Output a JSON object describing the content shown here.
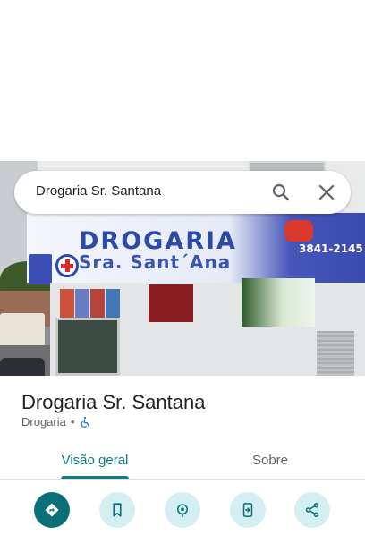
{
  "search": {
    "query": "Drogaria Sr. Santana"
  },
  "photo": {
    "sign_title": "DROGARIA",
    "sign_subtitle": "Sra. Sant´Ana",
    "sign_phone": "3841-2145"
  },
  "place": {
    "name": "Drogaria Sr. Santana",
    "category": "Drogaria",
    "separator": "•"
  },
  "tabs": [
    {
      "label": "Visão geral",
      "active": true
    },
    {
      "label": "Sobre",
      "active": false
    }
  ],
  "actions": [
    {
      "icon": "directions-icon"
    },
    {
      "icon": "bookmark-icon"
    },
    {
      "icon": "nearby-icon"
    },
    {
      "icon": "send-to-phone-icon"
    },
    {
      "icon": "share-icon"
    }
  ],
  "colors": {
    "accent": "#0b7d85",
    "primary_button": "#0b6f78",
    "secondary_button": "#d3eff3",
    "accessibility_icon": "#1a73e8"
  }
}
